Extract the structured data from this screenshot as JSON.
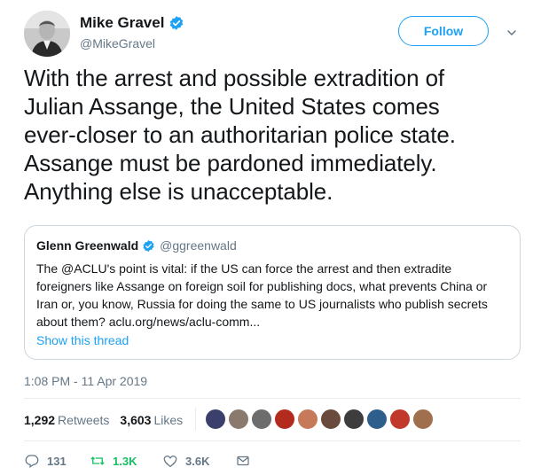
{
  "author": {
    "name": "Mike Gravel",
    "handle": "@MikeGravel"
  },
  "follow_label": "Follow",
  "tweet": {
    "lines": [
      "With the arrest and possible extradition of",
      "Julian Assange, the United States comes",
      "ever-closer to an authoritarian police state.",
      "Assange must be pardoned immediately.",
      "Anything else is unacceptable."
    ]
  },
  "quote": {
    "name": "Glenn Greenwald",
    "handle": "@ggreenwald",
    "lines": [
      "The @ACLU's point is vital: if the US can force the arrest and then extradite",
      "foreigners like Assange on foreign soil for publishing docs, what prevents China or",
      "Iran or, you know, Russia for doing the same to US journalists who publish secrets",
      "about them? aclu.org/news/aclu-comm..."
    ],
    "show_thread": "Show this thread"
  },
  "timestamp": "1:08 PM - 11 Apr 2019",
  "stats": {
    "retweets": "1,292",
    "retweets_label": "Retweets",
    "likes": "3,603",
    "likes_label": "Likes"
  },
  "likers": [
    {
      "color": "#3b3f6b"
    },
    {
      "color": "#8a7a6e"
    },
    {
      "color": "#6d6d6d"
    },
    {
      "color": "#b32b1d"
    },
    {
      "color": "#c77a5a"
    },
    {
      "color": "#6a4a3c"
    },
    {
      "color": "#3d3d3d"
    },
    {
      "color": "#2e5e8c"
    },
    {
      "color": "#c0392b"
    },
    {
      "color": "#a0704e"
    }
  ],
  "actions": {
    "replies": "131",
    "retweets": "1.3K",
    "likes": "3.6K"
  },
  "colors": {
    "accent": "#1da1f2",
    "retweet_green": "#17bf63",
    "muted": "#657786"
  },
  "icons": [
    "verified-badge-icon",
    "chevron-down-icon",
    "reply-icon",
    "retweet-icon",
    "heart-icon",
    "mail-icon"
  ]
}
